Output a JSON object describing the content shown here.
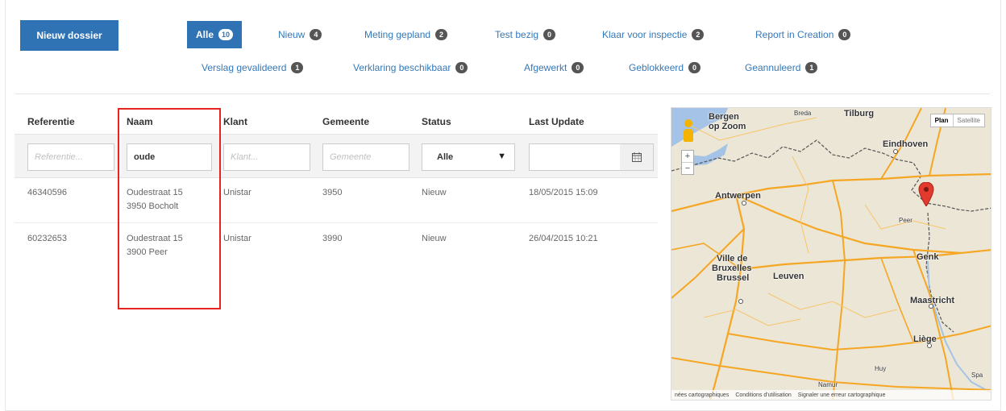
{
  "toolbar": {
    "new_label": "Nieuw dossier"
  },
  "filters_tabs": [
    {
      "label": "Alle",
      "count": "10"
    },
    {
      "label": "Nieuw",
      "count": "4"
    },
    {
      "label": "Meting gepland",
      "count": "2"
    },
    {
      "label": "Test bezig",
      "count": "0"
    },
    {
      "label": "Klaar voor inspectie",
      "count": "2"
    },
    {
      "label": "Report in Creation",
      "count": "0"
    },
    {
      "label": "Verslag gevalideerd",
      "count": "1"
    },
    {
      "label": "Verklaring beschikbaar",
      "count": "0"
    },
    {
      "label": "Afgewerkt",
      "count": "0"
    },
    {
      "label": "Geblokkeerd",
      "count": "0"
    },
    {
      "label": "Geannuleerd",
      "count": "1"
    }
  ],
  "table": {
    "headers": [
      "Referentie",
      "Naam",
      "Klant",
      "Gemeente",
      "Status",
      "Last Update"
    ],
    "filters": {
      "referentie_placeholder": "Referentie...",
      "naam_value": "oude",
      "klant_placeholder": "Klant...",
      "gemeente_placeholder": "Gemeente",
      "status_value": "Alle",
      "last_update_value": ""
    },
    "rows": [
      {
        "referentie": "46340596",
        "naam_line1": "Oudestraat 15",
        "naam_line2": "3950 Bocholt",
        "klant": "Unistar",
        "gemeente": "3950",
        "status": "Nieuw",
        "last_update": "18/05/2015 15:09"
      },
      {
        "referentie": "60232653",
        "naam_line1": "Oudestraat 15",
        "naam_line2": "3900 Peer",
        "klant": "Unistar",
        "gemeente": "3990",
        "status": "Nieuw",
        "last_update": "26/04/2015 10:21"
      }
    ]
  },
  "map": {
    "type_buttons": [
      "Plan",
      "Satellite"
    ],
    "zoom_in": "+",
    "zoom_out": "−",
    "labels": {
      "bergen": "Bergen",
      "op_zoom": "op Zoom",
      "breda": "Breda",
      "tilburg": "Tilburg",
      "eindhoven": "Eindhoven",
      "antwerpen": "Antwerpen",
      "peer": "Peer",
      "genk": "Genk",
      "ville_de": "Ville de",
      "bruxelles": "Bruxelles",
      "brussel": "Brussel",
      "leuven": "Leuven",
      "maastricht": "Maastricht",
      "liege": "Liège",
      "huy": "Huy",
      "namur": "Namur",
      "spa": "Spa"
    },
    "footer": [
      "nées cartographiques",
      "Conditions d'utilisation",
      "Signaler une erreur cartographique"
    ],
    "colors": {
      "land": "#ece6d6",
      "road": "#f5a623",
      "border": "#555",
      "water": "#a4c3e6",
      "pin": "#e23b2e"
    }
  }
}
